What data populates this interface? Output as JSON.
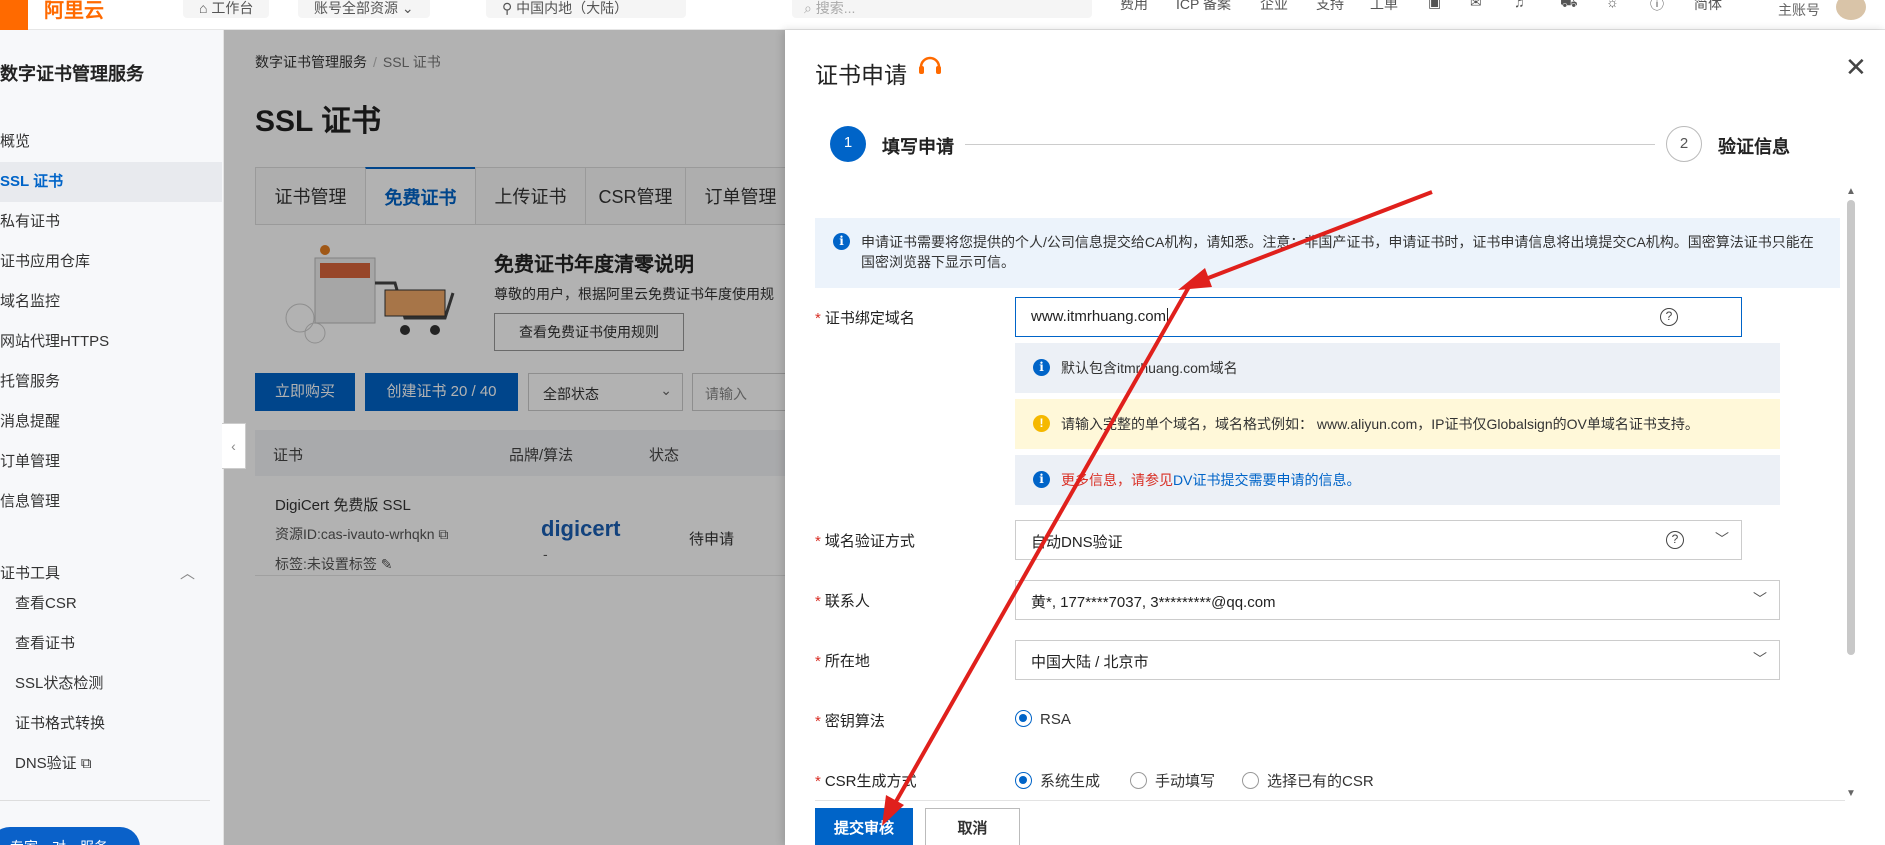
{
  "topbar": {
    "logo_text": "阿里云",
    "workbench": "工作台",
    "account_resources": "账号全部资源",
    "region": "中国内地（大陆）",
    "search_placeholder": "搜索...",
    "nav": [
      "费用",
      "ICP 备案",
      "企业",
      "支持",
      "工单",
      "简体"
    ],
    "account_label": "主账号"
  },
  "sidebar": {
    "title": "数字证书管理服务",
    "items": [
      {
        "label": "概览"
      },
      {
        "label": "SSL 证书",
        "active": true
      },
      {
        "label": "私有证书"
      },
      {
        "label": "证书应用仓库"
      },
      {
        "label": "域名监控"
      },
      {
        "label": "网站代理HTTPS"
      },
      {
        "label": "托管服务"
      },
      {
        "label": "消息提醒"
      },
      {
        "label": "订单管理"
      },
      {
        "label": "信息管理"
      }
    ],
    "tools_group": "证书工具",
    "tools": [
      "查看CSR",
      "查看证书",
      "SSL状态检测",
      "证书格式转换",
      "DNS验证"
    ],
    "bottom_pill": "专家一对一服务"
  },
  "main": {
    "breadcrumb": [
      "数字证书管理服务",
      "SSL 证书"
    ],
    "title": "SSL 证书",
    "tabs": [
      "证书管理",
      "免费证书",
      "上传证书",
      "CSR管理",
      "订单管理"
    ],
    "active_tab": 1,
    "promo": {
      "title": "免费证书年度清零说明",
      "text": "尊敬的用户，根据阿里云免费证书年度使用规",
      "button": "查看免费证书使用规则"
    },
    "buy_button": "立即购买",
    "create_button": "创建证书 20 / 40",
    "status_filter": "全部状态",
    "search_placeholder": "请输入",
    "table": {
      "headers": [
        "证书",
        "品牌/算法",
        "状态"
      ],
      "rows": [
        {
          "name": "DigiCert 免费版 SSL",
          "resource_id": "资源ID:cas-ivauto-wrhqkn",
          "tag": "标签:未设置标签",
          "brand": "digicert",
          "algo": "-",
          "status": "待申请"
        }
      ]
    }
  },
  "drawer": {
    "title": "证书申请",
    "steps": [
      {
        "num": "1",
        "label": "填写申请"
      },
      {
        "num": "2",
        "label": "验证信息"
      }
    ],
    "info_banner": "申请证书需要将您提供的个人/公司信息提交给CA机构，请知悉。注意：非国产证书，申请证书时，证书申请信息将出境提交CA机构。国密算法证书只能在国密浏览器下显示可信。",
    "form": {
      "domain_label": "证书绑定域名",
      "domain_value": "www.itmrhuang.com",
      "note_default": "默认包含itmrhuang.com域名",
      "note_warn": "请输入完整的单个域名，域名格式例如： www.aliyun.com，IP证书仅Globalsign的OV单域名证书支持。",
      "note_more_red": "更多信息，请参见",
      "note_more_link": "DV证书提交需要申请的信息。",
      "verify_label": "域名验证方式",
      "verify_value": "自动DNS验证",
      "contact_label": "联系人",
      "contact_value": "黄*, 177****7037, 3*********@qq.com",
      "location_label": "所在地",
      "location_value": "中国大陆 / 北京市",
      "algo_label": "密钥算法",
      "algo_options": [
        "RSA"
      ],
      "csr_label": "CSR生成方式",
      "csr_options": [
        "系统生成",
        "手动填写",
        "选择已有的CSR"
      ]
    },
    "submit": "提交审核",
    "cancel": "取消"
  },
  "annotation_color": "#e0201c"
}
